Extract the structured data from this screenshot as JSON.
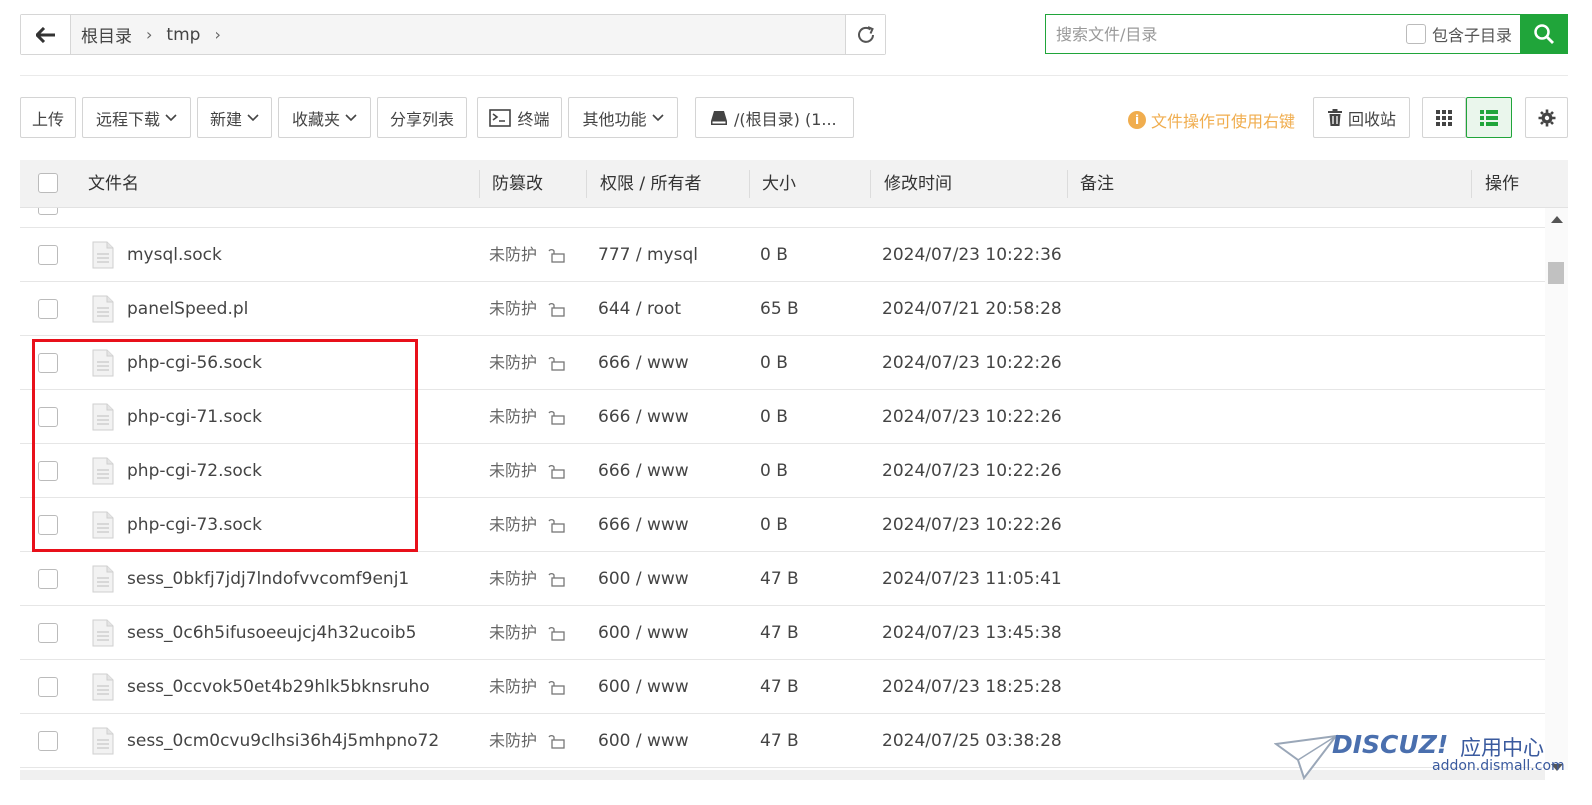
{
  "breadcrumb": {
    "items": [
      "根目录",
      "tmp"
    ]
  },
  "search": {
    "placeholder": "搜索文件/目录",
    "include_subdir_label": "包含子目录"
  },
  "toolbar": {
    "upload": "上传",
    "remote_download": "远程下载",
    "new": "新建",
    "favorites": "收藏夹",
    "share_list": "分享列表",
    "terminal": "终端",
    "other_functions": "其他功能",
    "disk": "/(根目录) (1...",
    "tip": "文件操作可使用右键",
    "recycle_bin": "回收站"
  },
  "table": {
    "headers": {
      "filename": "文件名",
      "tamper": "防篡改",
      "perm_owner": "权限 / 所有者",
      "size": "大小",
      "mtime": "修改时间",
      "remark": "备注",
      "actions": "操作"
    },
    "rows": [
      {
        "name": "mysql.sock",
        "protect": "未防护",
        "perm": "777 / mysql",
        "size": "0 B",
        "mtime": "2024/07/23 10:22:36"
      },
      {
        "name": "panelSpeed.pl",
        "protect": "未防护",
        "perm": "644 / root",
        "size": "65 B",
        "mtime": "2024/07/21 20:58:28"
      },
      {
        "name": "php-cgi-56.sock",
        "protect": "未防护",
        "perm": "666 / www",
        "size": "0 B",
        "mtime": "2024/07/23 10:22:26"
      },
      {
        "name": "php-cgi-71.sock",
        "protect": "未防护",
        "perm": "666 / www",
        "size": "0 B",
        "mtime": "2024/07/23 10:22:26"
      },
      {
        "name": "php-cgi-72.sock",
        "protect": "未防护",
        "perm": "666 / www",
        "size": "0 B",
        "mtime": "2024/07/23 10:22:26"
      },
      {
        "name": "php-cgi-73.sock",
        "protect": "未防护",
        "perm": "666 / www",
        "size": "0 B",
        "mtime": "2024/07/23 10:22:26"
      },
      {
        "name": "sess_0bkfj7jdj7lndofvvcomf9enj1",
        "protect": "未防护",
        "perm": "600 / www",
        "size": "47 B",
        "mtime": "2024/07/23 11:05:41"
      },
      {
        "name": "sess_0c6h5ifusoeeujcj4h32ucoib5",
        "protect": "未防护",
        "perm": "600 / www",
        "size": "47 B",
        "mtime": "2024/07/23 13:45:38"
      },
      {
        "name": "sess_0ccvok50et4b29hlk5bknsruho",
        "protect": "未防护",
        "perm": "600 / www",
        "size": "47 B",
        "mtime": "2024/07/23 18:25:28"
      },
      {
        "name": "sess_0cm0cvu9clhsi36h4j5mhpno72",
        "protect": "未防护",
        "perm": "600 / www",
        "size": "47 B",
        "mtime": "2024/07/25 03:38:28"
      }
    ]
  },
  "watermark": {
    "brand": "DISCUZ!",
    "cn": "应用中心",
    "url": "addon.dismall.com"
  },
  "colors": {
    "accent": "#20a53a",
    "annotation": "#e8101a",
    "tip": "#f0ad4e"
  }
}
